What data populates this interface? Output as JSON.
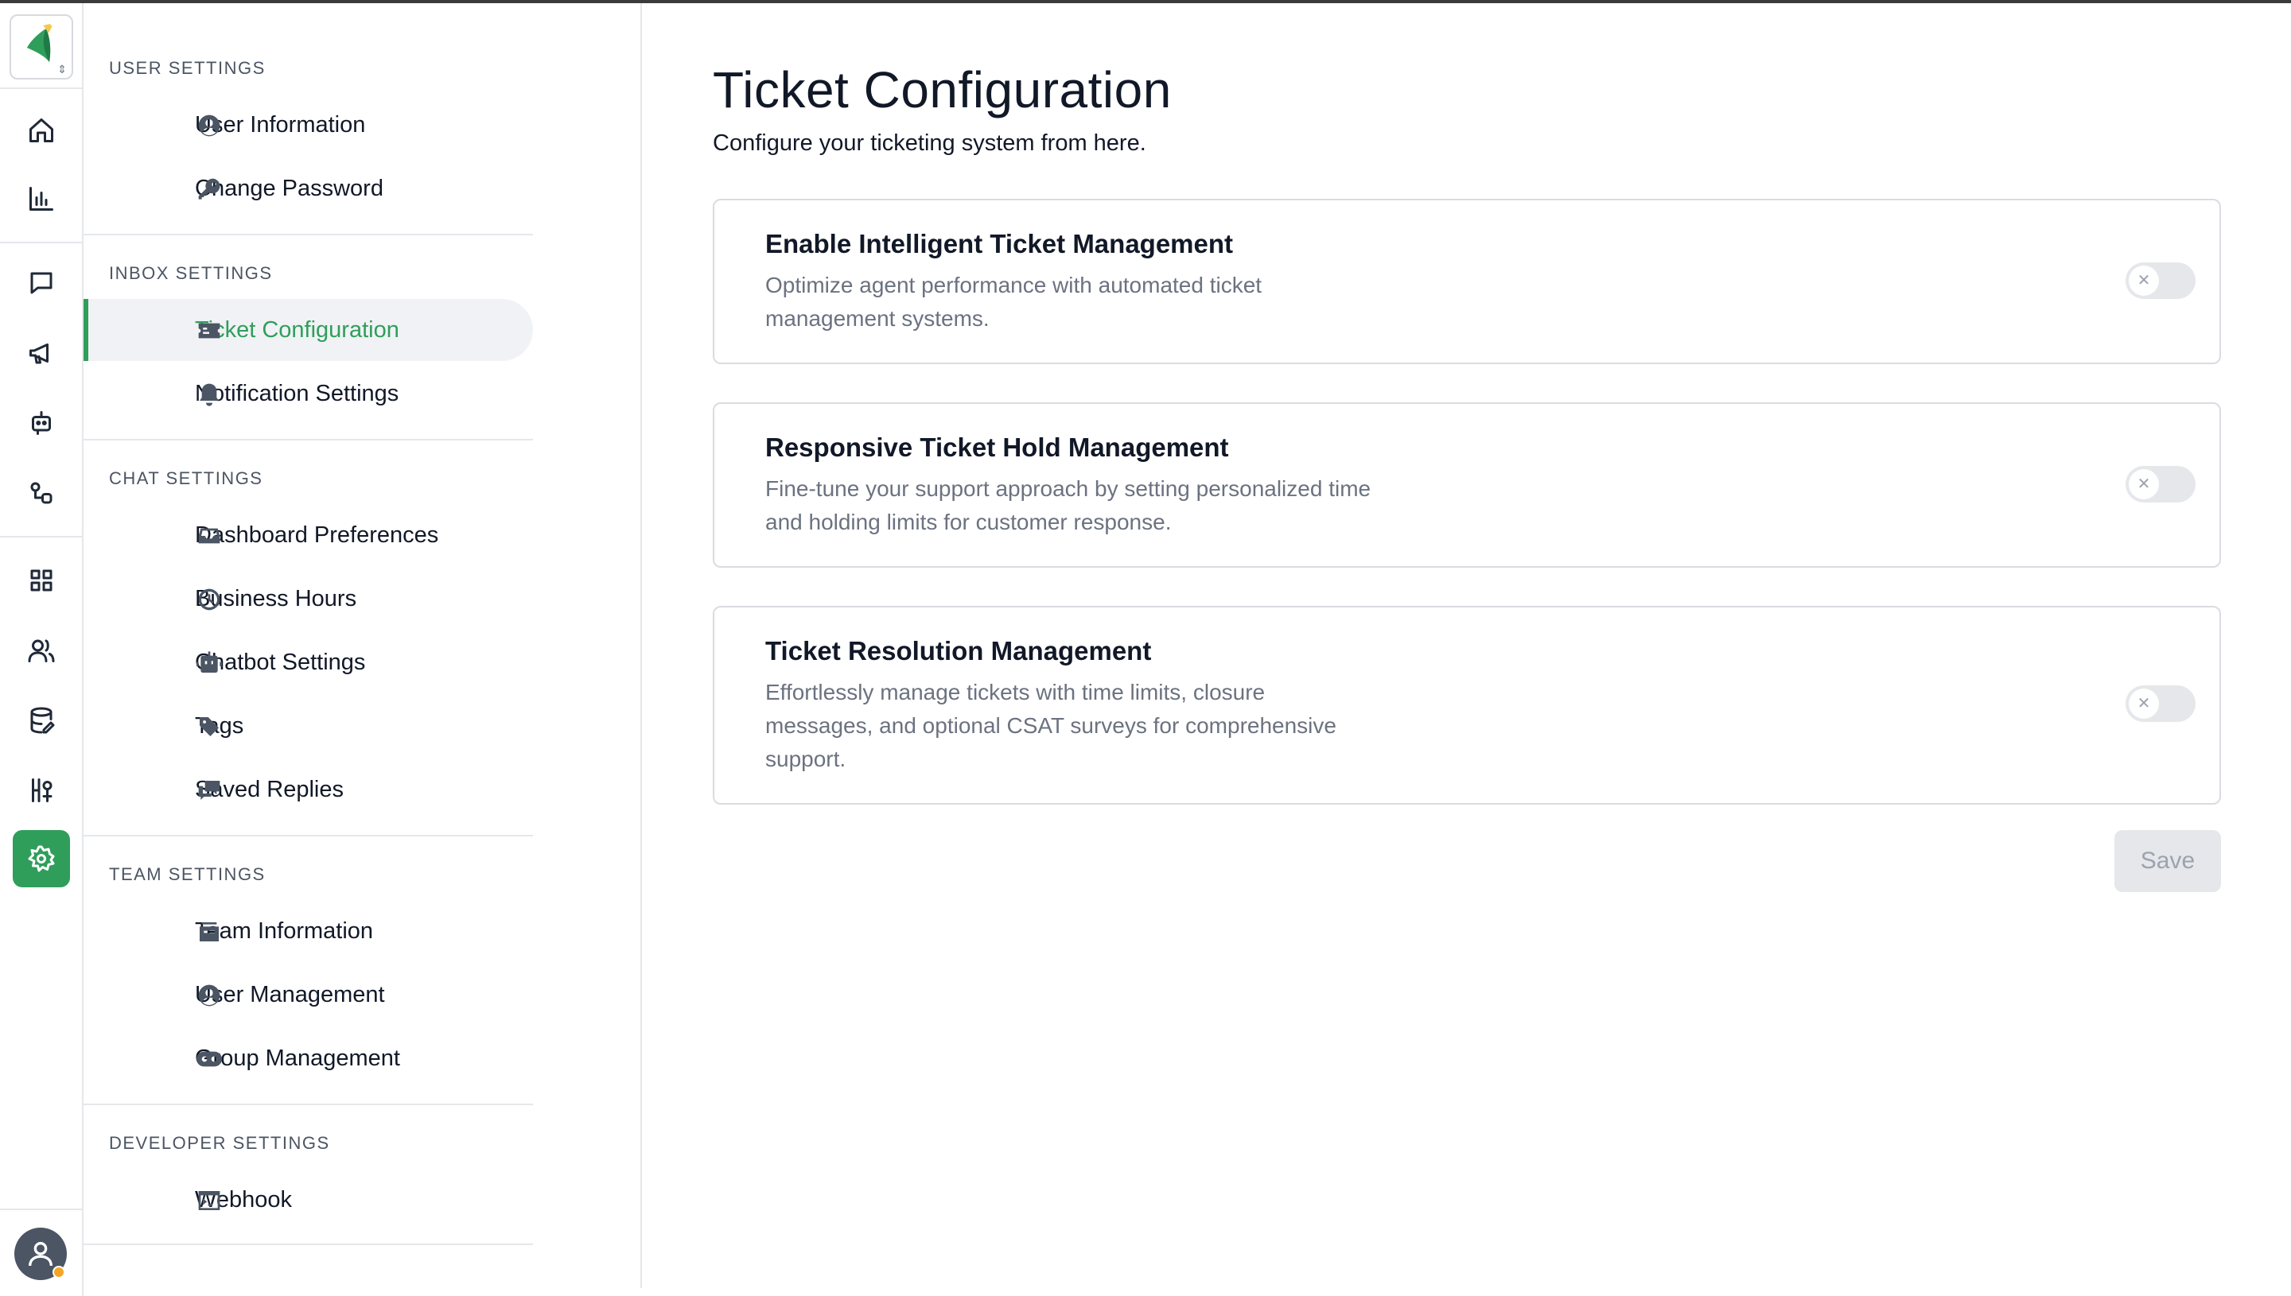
{
  "nav": {
    "sections": [
      {
        "title": "USER SETTINGS",
        "items": [
          {
            "label": "User Information",
            "icon": "user-circle-icon"
          },
          {
            "label": "Change Password",
            "icon": "key-icon"
          }
        ]
      },
      {
        "title": "INBOX SETTINGS",
        "items": [
          {
            "label": "Ticket Configuration",
            "icon": "ticket-icon",
            "active": true
          },
          {
            "label": "Notification Settings",
            "icon": "bell-icon"
          }
        ]
      },
      {
        "title": "CHAT SETTINGS",
        "items": [
          {
            "label": "Dashboard Preferences",
            "icon": "inbox-icon"
          },
          {
            "label": "Business Hours",
            "icon": "clock-icon"
          },
          {
            "label": "Chatbot Settings",
            "icon": "robot-icon"
          },
          {
            "label": "Tags",
            "icon": "tag-icon"
          },
          {
            "label": "Saved Replies",
            "icon": "chat-bubbles-icon"
          }
        ]
      },
      {
        "title": "TEAM SETTINGS",
        "items": [
          {
            "label": "Team Information",
            "icon": "team-icon"
          },
          {
            "label": "User Management",
            "icon": "user-circle-icon"
          },
          {
            "label": "Group Management",
            "icon": "group-icon"
          }
        ]
      },
      {
        "title": "DEVELOPER SETTINGS",
        "items": [
          {
            "label": "Webhook",
            "icon": "terminal-icon"
          }
        ]
      }
    ]
  },
  "main": {
    "title": "Ticket Configuration",
    "subtitle": "Configure your ticketing system from here.",
    "cards": [
      {
        "title": "Enable Intelligent Ticket Management",
        "desc_lines": [
          "Optimize agent performance with automated ticket",
          "management systems."
        ],
        "enabled": false
      },
      {
        "title": "Responsive Ticket Hold Management",
        "desc_lines": [
          "Fine-tune your support approach by setting personalized time",
          "and holding limits for customer response."
        ],
        "enabled": false
      },
      {
        "title": "Ticket Resolution Management",
        "desc_lines": [
          "Effortlessly manage tickets with time limits, closure",
          "messages, and optional CSAT surveys for comprehensive",
          "support."
        ],
        "enabled": false
      }
    ],
    "save_label": "Save"
  },
  "colors": {
    "accent": "#2f9e5b",
    "presence": "#f5a524"
  }
}
